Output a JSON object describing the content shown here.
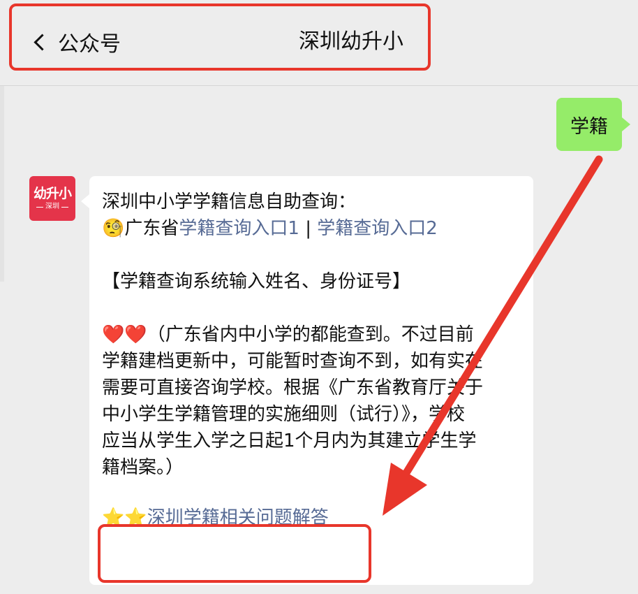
{
  "header": {
    "back_label": "公众号",
    "title": "深圳幼升小"
  },
  "user_message": "学籍",
  "avatar": {
    "line1": "幼升小",
    "line2": "深圳"
  },
  "bot_message": {
    "line1": "深圳中小学学籍信息自助查询：",
    "line2_emoji": "🧐",
    "line2_prefix": "广东省",
    "link1": "学籍查询入口1",
    "separator": " | ",
    "link2": "学籍查询入口2",
    "line3": "【学籍查询系统输入姓名、身份证号】",
    "hearts": "❤️❤️",
    "para_lines": [
      "（广东省内中小学的都能查到。不过目前",
      "学籍建档更新中，可能暂时查询不到，如有实在",
      "需要可直接咨询学校。根据《广东省教育厅关于",
      "中小学生学籍管理的实施细则（试行）》，学校",
      "应当从学生入学之日起1个月内为其建立学生学",
      "籍档案。）"
    ],
    "stars": "⭐⭐",
    "faq_link": "深圳学籍相关问题解答"
  },
  "colors": {
    "background": "#ededed",
    "user_bubble": "#95ec69",
    "link": "#576b95",
    "annotation": "#e8362b",
    "avatar": "#e4344a"
  }
}
